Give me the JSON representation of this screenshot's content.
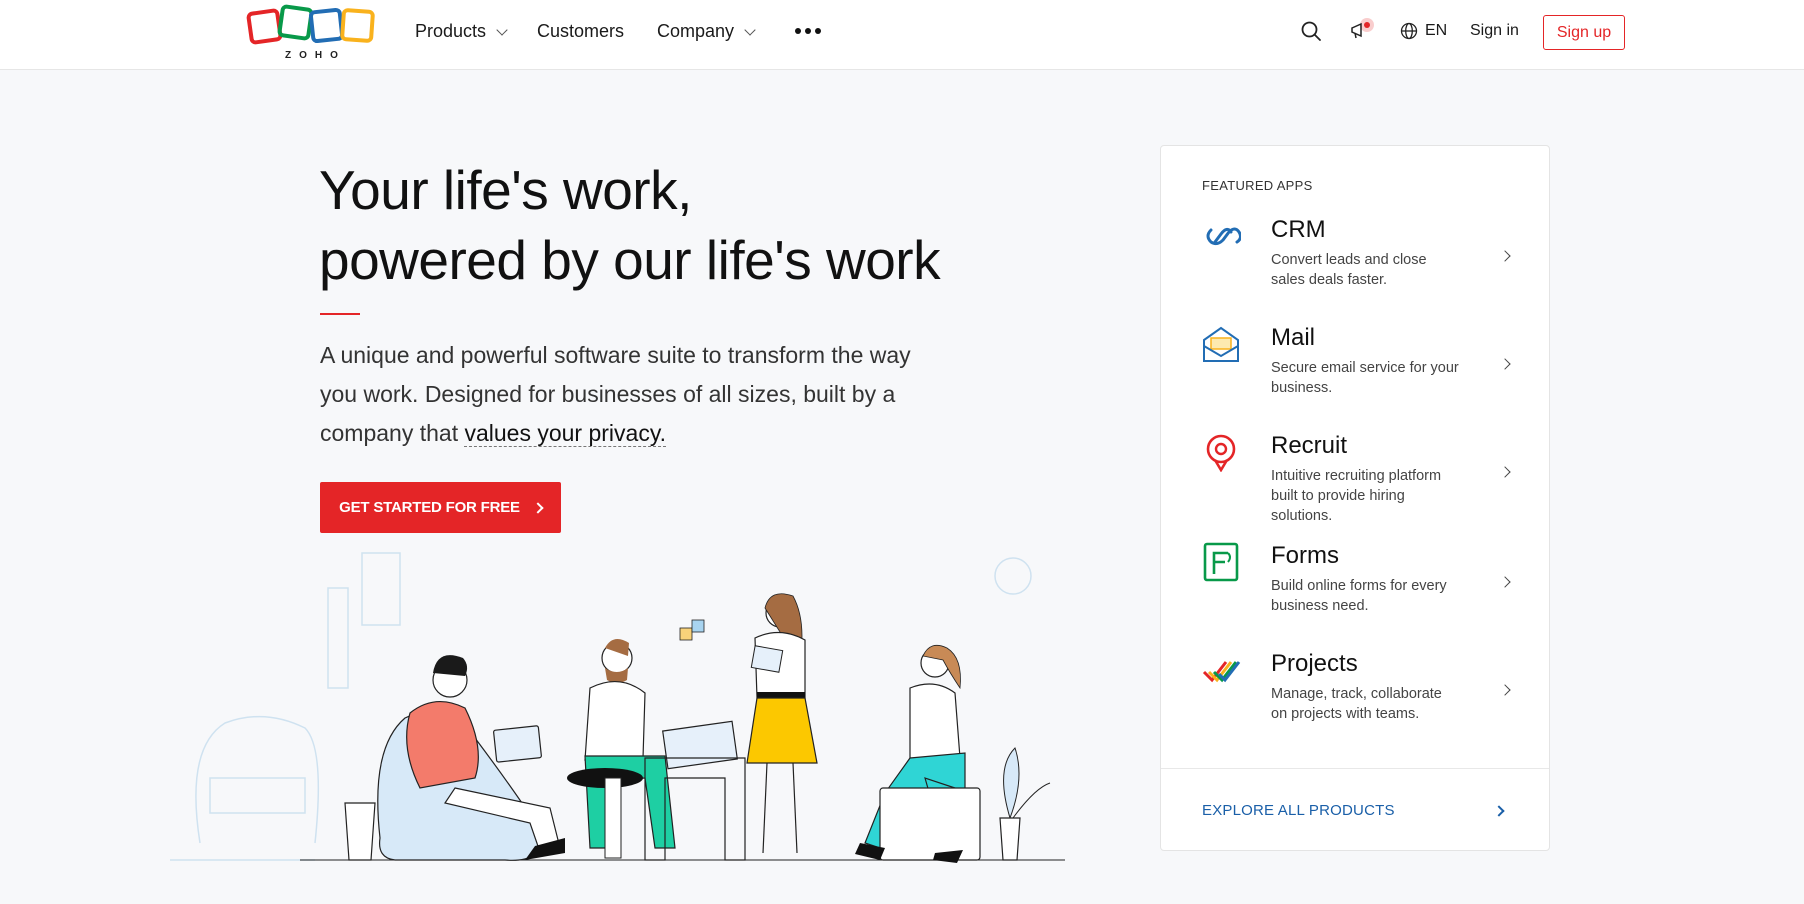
{
  "header": {
    "logo_text": "ZOHO",
    "nav": {
      "products": "Products",
      "customers": "Customers",
      "company": "Company"
    },
    "lang": "EN",
    "sign_in": "Sign in",
    "sign_up": "Sign up"
  },
  "hero": {
    "title_line1": "Your life's work,",
    "title_line2": "powered by our life's work",
    "desc_part1": "A unique and powerful software suite to transform the way you work. Designed for businesses of all sizes, built by a company that ",
    "desc_link": "values your privacy.",
    "cta": "GET STARTED FOR FREE"
  },
  "featured": {
    "label": "FEATURED APPS",
    "apps": [
      {
        "name": "CRM",
        "desc": "Convert leads and close sales deals faster."
      },
      {
        "name": "Mail",
        "desc": "Secure email service for your business."
      },
      {
        "name": "Recruit",
        "desc": "Intuitive recruiting platform built to provide hiring solutions."
      },
      {
        "name": "Forms",
        "desc": "Build online forms for every business need."
      },
      {
        "name": "Projects",
        "desc": "Manage, track, collaborate on projects with teams."
      }
    ],
    "explore": "EXPLORE ALL PRODUCTS"
  },
  "colors": {
    "brand_red": "#e42527",
    "logo_red": "#e42527",
    "logo_green": "#089949",
    "logo_blue": "#226db4",
    "logo_yellow": "#f9b21d",
    "link_blue": "#1a5fa8"
  },
  "icons": [
    "search-icon",
    "announcement-icon",
    "globe-icon",
    "more-dots-icon",
    "crm-icon",
    "mail-icon",
    "recruit-icon",
    "forms-icon",
    "projects-icon"
  ]
}
